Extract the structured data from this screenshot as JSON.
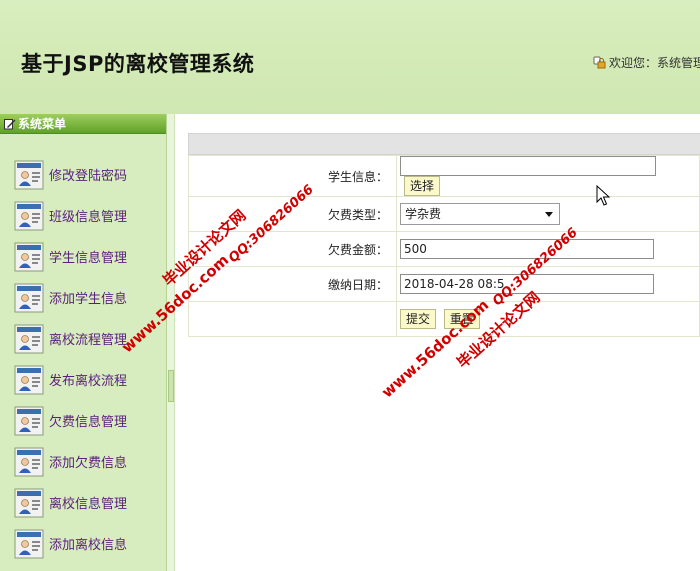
{
  "header": {
    "title": "基于JSP的离校管理系统",
    "welcome": "欢迎您：系统管理"
  },
  "sidebar": {
    "title": "系统菜单",
    "items": [
      {
        "label": "修改登陆密码"
      },
      {
        "label": "班级信息管理"
      },
      {
        "label": "学生信息管理"
      },
      {
        "label": "添加学生信息"
      },
      {
        "label": "离校流程管理"
      },
      {
        "label": "发布离校流程"
      },
      {
        "label": "欠费信息管理"
      },
      {
        "label": "添加欠费信息"
      },
      {
        "label": "离校信息管理"
      },
      {
        "label": "添加离校信息"
      }
    ]
  },
  "form": {
    "student_label": "学生信息：",
    "student_value": "",
    "choose_button": "选择",
    "fee_type_label": "欠费类型：",
    "fee_type_value": "学杂费",
    "amount_label": "欠费金额：",
    "amount_value": "500",
    "date_label": "缴纳日期：",
    "date_value": "2018-04-28 08:5",
    "submit_button": "提交",
    "reset_button": "重置"
  },
  "watermark": {
    "site": "www.56doc.com",
    "name": "毕业设计论文网",
    "qq": "QQ:306826066"
  },
  "colors": {
    "header_bg": "#d8eebe",
    "sidebar_head": "#6aa832",
    "menu_text": "#5a1f7a",
    "watermark": "#d00000"
  }
}
